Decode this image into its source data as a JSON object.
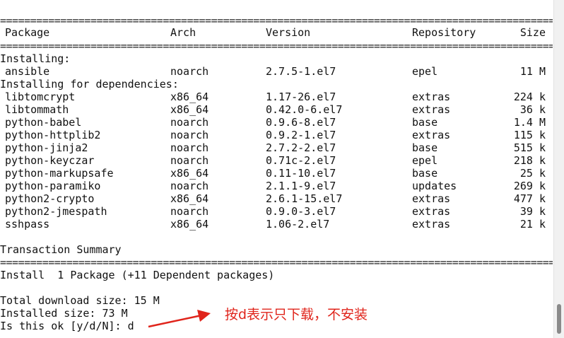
{
  "separator": "================================================================================================================",
  "header": {
    "package": "Package",
    "arch": "Arch",
    "version": "Version",
    "repository": "Repository",
    "size": "Size"
  },
  "sections": {
    "installing": "Installing:",
    "deps": "Installing for dependencies:"
  },
  "installing": [
    {
      "package": "ansible",
      "arch": "noarch",
      "version": "2.7.5-1.el7",
      "repo": "epel",
      "size": "11 M"
    }
  ],
  "dependencies": [
    {
      "package": "libtomcrypt",
      "arch": "x86_64",
      "version": "1.17-26.el7",
      "repo": "extras",
      "size": "224 k"
    },
    {
      "package": "libtommath",
      "arch": "x86_64",
      "version": "0.42.0-6.el7",
      "repo": "extras",
      "size": "36 k"
    },
    {
      "package": "python-babel",
      "arch": "noarch",
      "version": "0.9.6-8.el7",
      "repo": "base",
      "size": "1.4 M"
    },
    {
      "package": "python-httplib2",
      "arch": "noarch",
      "version": "0.9.2-1.el7",
      "repo": "extras",
      "size": "115 k"
    },
    {
      "package": "python-jinja2",
      "arch": "noarch",
      "version": "2.7.2-2.el7",
      "repo": "base",
      "size": "515 k"
    },
    {
      "package": "python-keyczar",
      "arch": "noarch",
      "version": "0.71c-2.el7",
      "repo": "epel",
      "size": "218 k"
    },
    {
      "package": "python-markupsafe",
      "arch": "x86_64",
      "version": "0.11-10.el7",
      "repo": "base",
      "size": "25 k"
    },
    {
      "package": "python-paramiko",
      "arch": "noarch",
      "version": "2.1.1-9.el7",
      "repo": "updates",
      "size": "269 k"
    },
    {
      "package": "python2-crypto",
      "arch": "x86_64",
      "version": "2.6.1-15.el7",
      "repo": "extras",
      "size": "477 k"
    },
    {
      "package": "python2-jmespath",
      "arch": "noarch",
      "version": "0.9.0-3.el7",
      "repo": "extras",
      "size": "39 k"
    },
    {
      "package": "sshpass",
      "arch": "x86_64",
      "version": "1.06-2.el7",
      "repo": "extras",
      "size": "21 k"
    }
  ],
  "summary": {
    "title": "Transaction Summary",
    "install_line": "Install  1 Package (+11 Dependent packages)",
    "total_download": "Total download size: 15 M",
    "installed_size": "Installed size: 73 M",
    "prompt": "Is this ok [y/d/N]: d"
  },
  "annotation": {
    "text": "按d表示只下载，不安装",
    "color": "#e0241b"
  }
}
